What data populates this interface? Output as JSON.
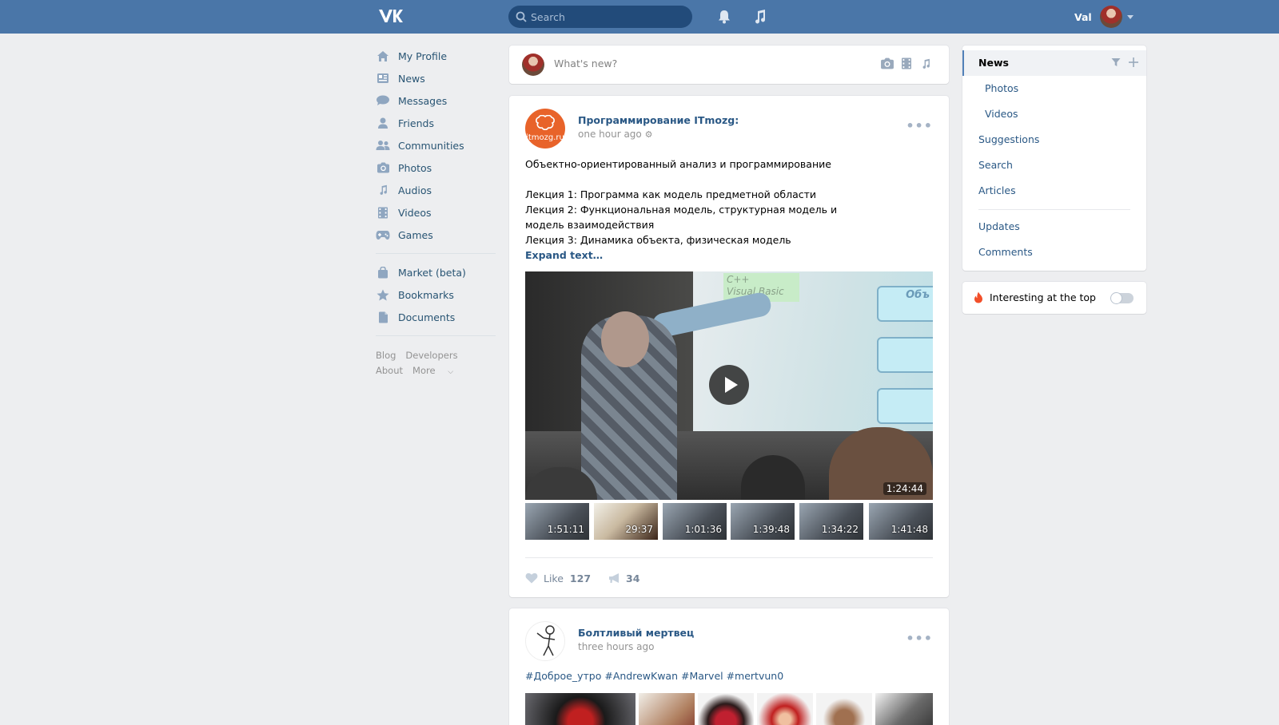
{
  "header": {
    "logo": "vk-logo",
    "search_placeholder": "Search",
    "user_name": "Val"
  },
  "left_nav": {
    "items": [
      {
        "label": "My Profile",
        "icon": "home-icon"
      },
      {
        "label": "News",
        "icon": "news-icon"
      },
      {
        "label": "Messages",
        "icon": "messages-icon"
      },
      {
        "label": "Friends",
        "icon": "friend-icon"
      },
      {
        "label": "Communities",
        "icon": "communities-icon"
      },
      {
        "label": "Photos",
        "icon": "camera-icon"
      },
      {
        "label": "Audios",
        "icon": "music-note-icon"
      },
      {
        "label": "Videos",
        "icon": "film-icon"
      },
      {
        "label": "Games",
        "icon": "gamepad-icon"
      }
    ],
    "items2": [
      {
        "label": "Market (beta)",
        "icon": "bag-icon"
      },
      {
        "label": "Bookmarks",
        "icon": "star-icon"
      },
      {
        "label": "Documents",
        "icon": "document-icon"
      }
    ],
    "footer": {
      "blog": "Blog",
      "developers": "Developers",
      "about": "About",
      "more": "More"
    }
  },
  "composer": {
    "placeholder": "What's new?"
  },
  "post1": {
    "author": "Программирование ITmozg:",
    "avatar_text": "itmozg.ru",
    "time": "one hour ago",
    "text_lines": [
      "Объектно-ориентированный анализ и программирование",
      "",
      "Лекция 1: Программа как модель предметной области",
      "Лекция 2: Функциональная модель, структурная модель и модель взаимодействия",
      "Лекция 3: Динамика объекта, физическая модель"
    ],
    "expand": "Expand text…",
    "video": {
      "duration": "1:24:44",
      "slide_title": "C++\nVisual Basic",
      "slide_word": "Объ"
    },
    "thumbs": [
      "1:51:11",
      "29:37",
      "1:01:36",
      "1:39:48",
      "1:34:22",
      "1:41:48"
    ],
    "like_label": "Like",
    "likes": "127",
    "shares": "34"
  },
  "post2": {
    "author": "Болтливый мертвец",
    "time": "three hours ago",
    "tags": "#Доброе_утро #AndrewKwan #Marvel #mertvun0"
  },
  "right_menu": {
    "items": [
      "News",
      "Photos",
      "Videos",
      "Suggestions",
      "Search",
      "Articles",
      "Updates",
      "Comments"
    ]
  },
  "interesting": {
    "label": "Interesting at the top",
    "enabled": false
  },
  "colors": {
    "header": "#4a76a8",
    "link": "#2a5885",
    "background": "#edeef0"
  }
}
